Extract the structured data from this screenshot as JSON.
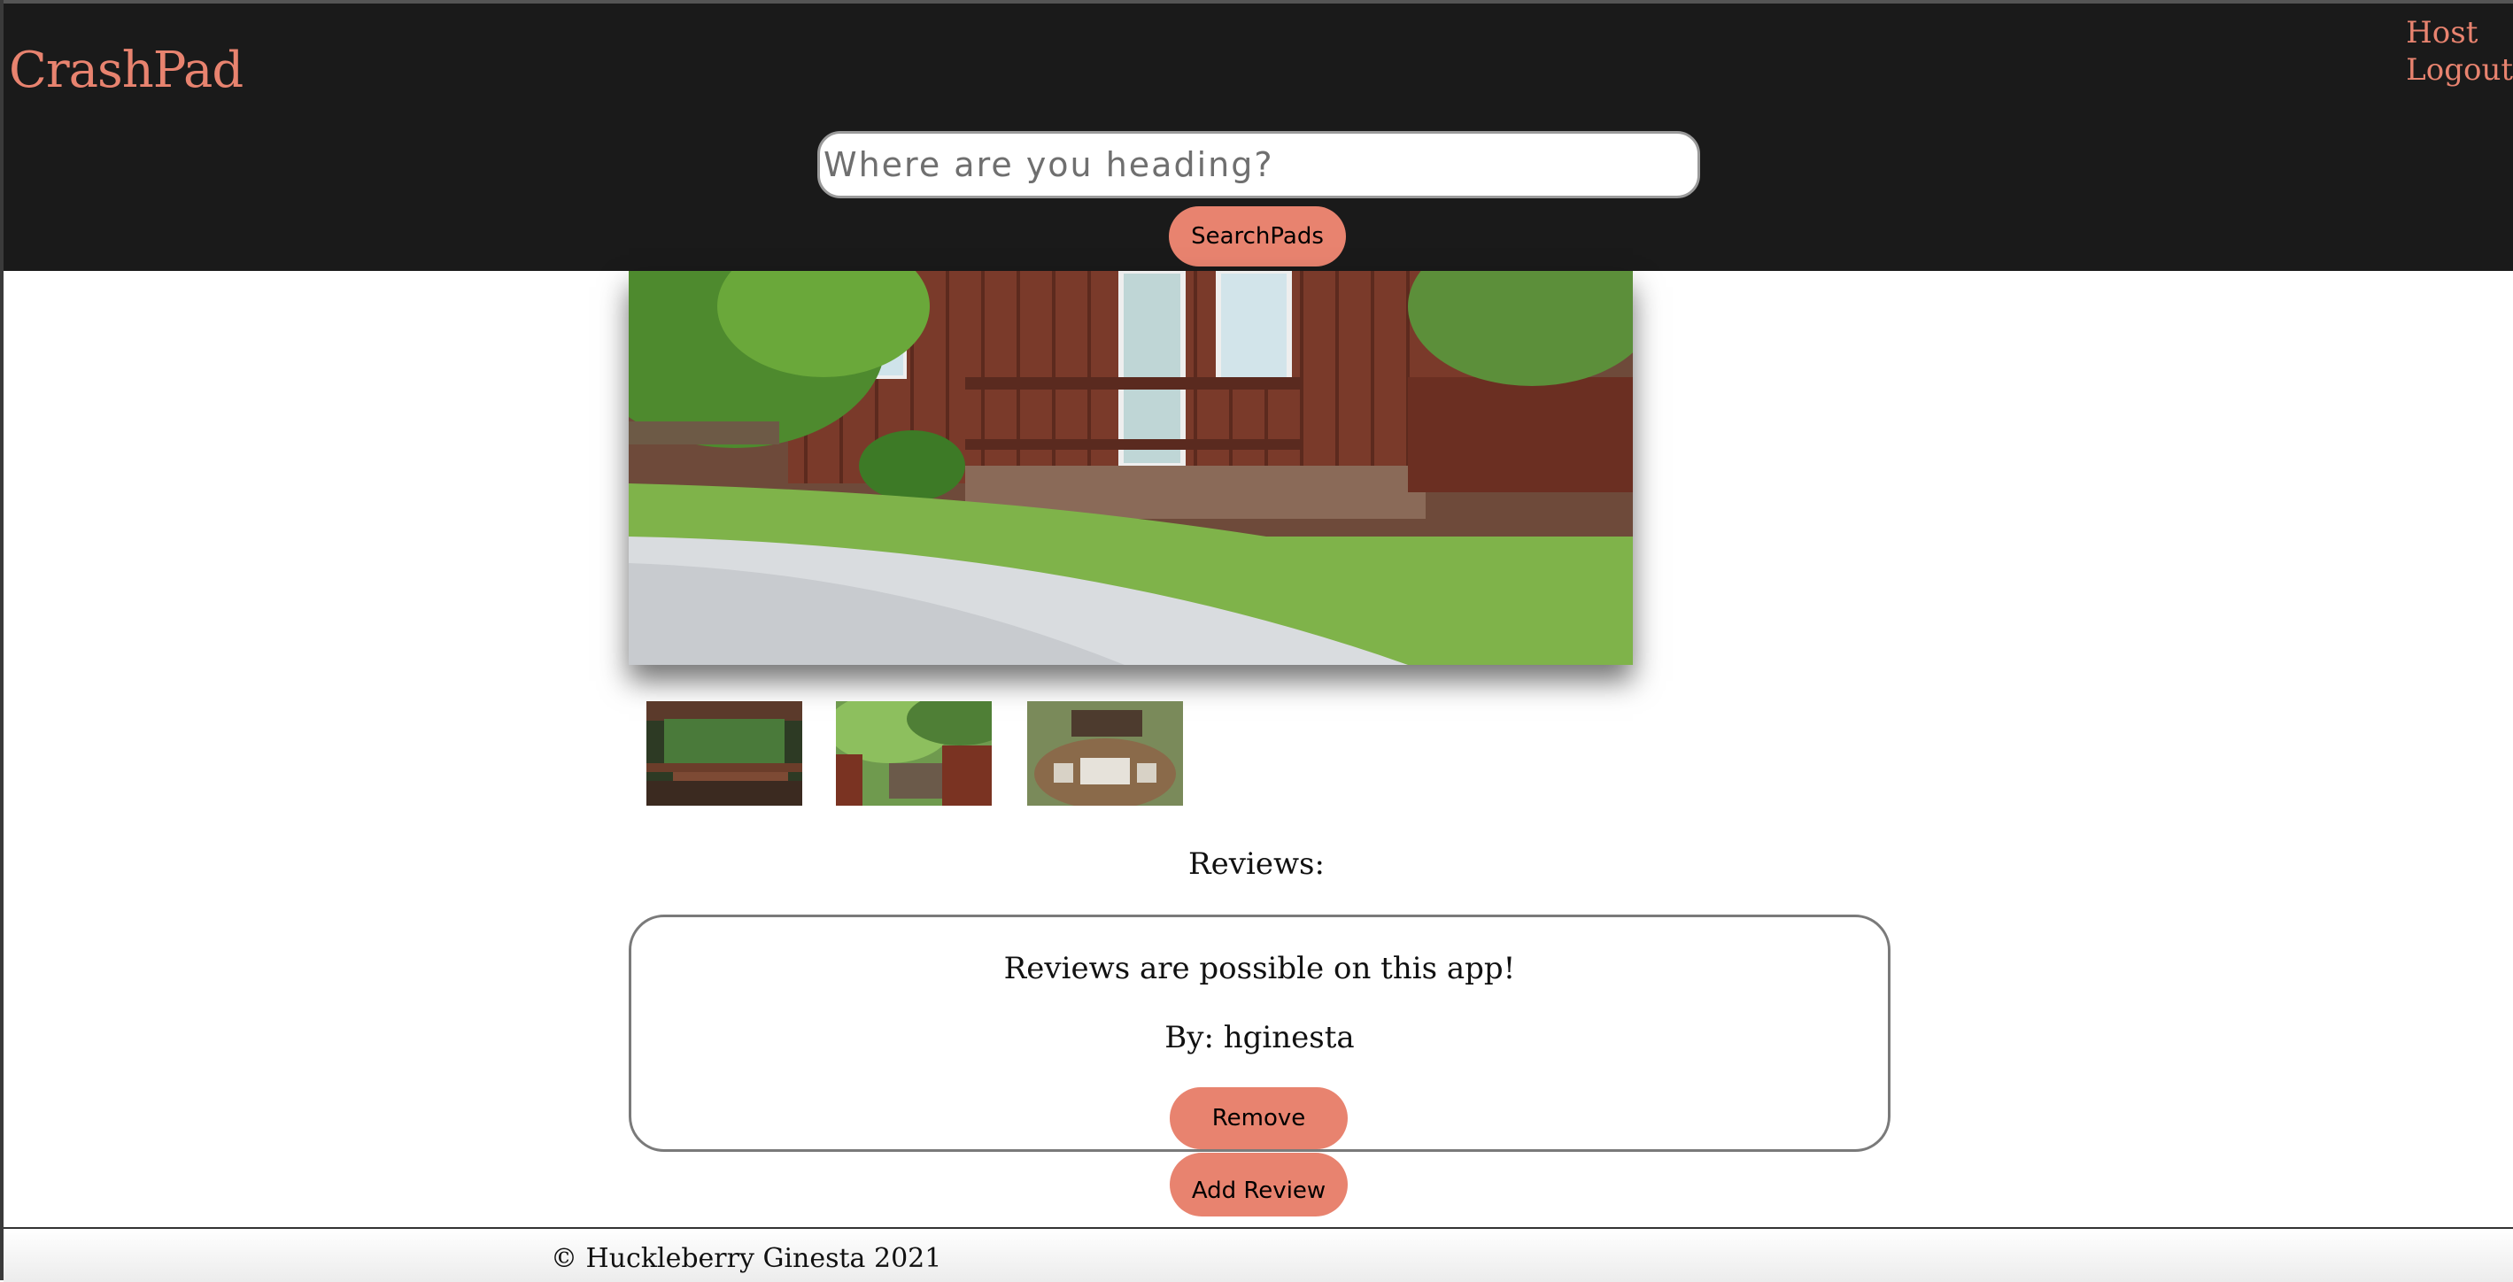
{
  "header": {
    "brand": "CrashPad",
    "nav": [
      "Host",
      "Logout"
    ],
    "search": {
      "placeholder": "Where are you heading?",
      "value": ""
    },
    "search_button_label": "SearchPads"
  },
  "gallery": {
    "main_image": "cabin-porch-photo",
    "thumbnails": [
      "porch-deck-photo",
      "creek-deck-photo",
      "patio-table-photo"
    ]
  },
  "reviews": {
    "heading": "Reviews:",
    "items": [
      {
        "text": "Reviews are possible on this app!",
        "author": "By: hginesta",
        "remove_label": "Remove"
      }
    ],
    "add_label": "Add Review"
  },
  "footer": {
    "text": "© Huckleberry Ginesta 2021"
  },
  "colors": {
    "header_bg": "#1a1a1a",
    "accent": "#e8836f"
  }
}
